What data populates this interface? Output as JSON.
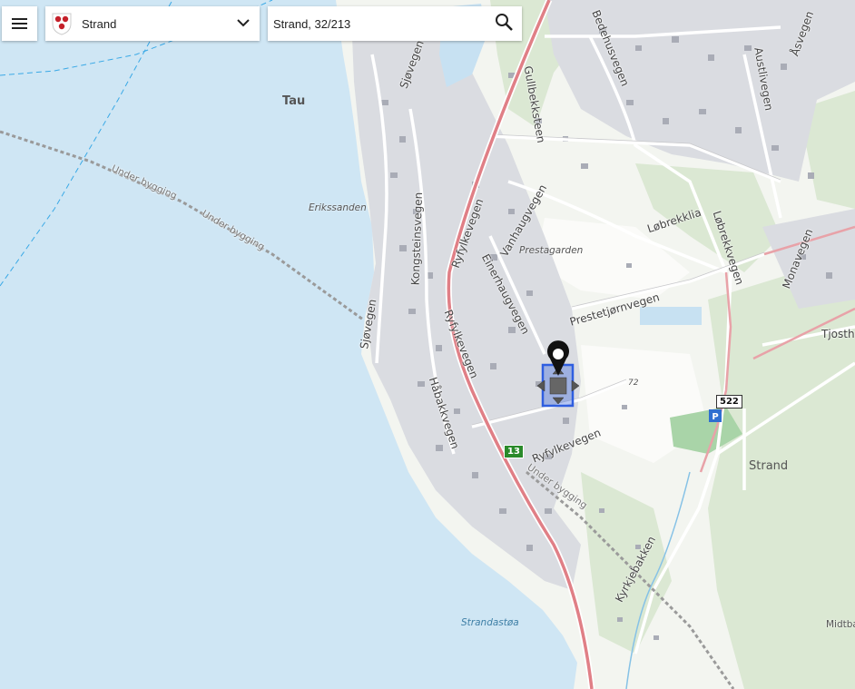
{
  "toolbar": {
    "municipality_name": "Strand",
    "search_value": "Strand, 32/213"
  },
  "icons": {
    "menu": "hamburger-menu-icon",
    "coat_of_arms": "strand-coat-of-arms-icon",
    "dropdown": "chevron-down-icon",
    "search": "search-icon",
    "marker": "map-pin-icon",
    "move": "move-arrows-icon",
    "parking": "parking-icon"
  },
  "colors": {
    "sea": "#cfe6f4",
    "land": "#f4f6f2",
    "forest": "#dde9d6",
    "built": "#d9dbe0",
    "building": "#a9acb6",
    "main_road": "#e07f86",
    "selection": "#2f5ee0",
    "ferry": "#3aa9e6"
  },
  "map": {
    "labels": {
      "tau": "Tau",
      "under_bygging_1": "Under bygging",
      "under_bygging_2": "Under bygging",
      "under_bygging_3": "Under bygging",
      "erikssanden": "Erikssanden",
      "kongsteinsvegen": "Kongsteinsvegen",
      "sjovegen": "Sjøvegen",
      "habakkvegen": "Håbakkvegen",
      "ryfylkevegen_1": "Ryfylkevegen",
      "ryfylkevegen_2": "Ryfylkevegen",
      "ryfylkevegen_3": "Ryfylkevegen",
      "einerhaugvegen": "Einerhaugvegen",
      "vanhaugvegen": "Vanhaugvegen",
      "prestagarden": "Prestagarden",
      "gullbekksteen": "Gullbekksteen",
      "bedehusvegen": "Bedehusvegen",
      "austlivegen": "Austlivegen",
      "asvegen": "Åsvegen",
      "lobrekklia": "Løbrekklia",
      "lobrekkvegen": "Løbrekkvegen",
      "prestetjornvegen": "Prestetjørnvegen",
      "monavegen": "Monavegen",
      "tjosth": "Tjosth",
      "strand": "Strand",
      "kyrkjebakken": "Kyrkjebakken",
      "strandastoa": "Strandastøa",
      "midtba": "Midtba",
      "sjovegen_top": "Sjøvegen",
      "elevation": "72"
    },
    "route_13": "13",
    "route_522": "522"
  }
}
